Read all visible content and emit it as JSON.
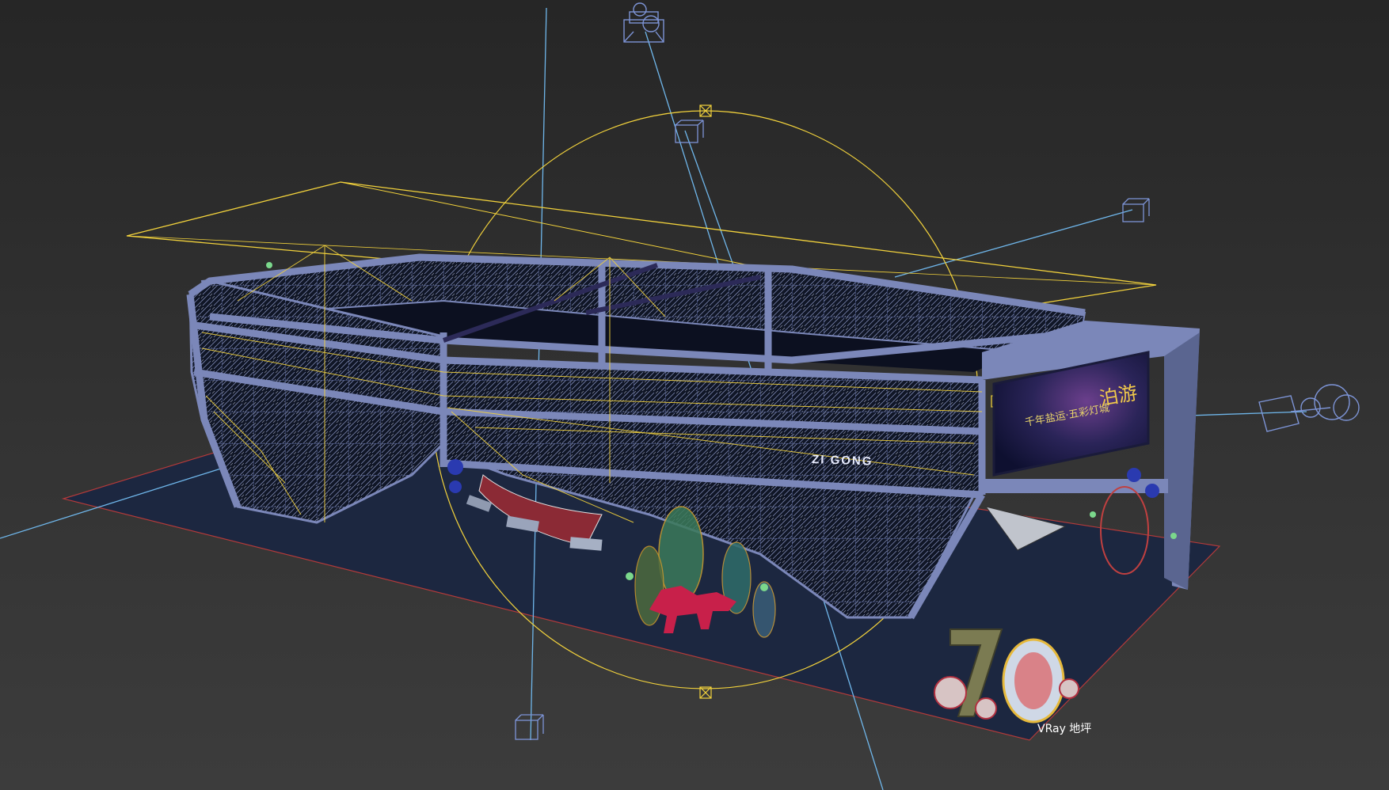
{
  "viewport": {
    "background_top": "#262626",
    "background_bottom": "#3c3c3c"
  },
  "colors": {
    "structure": "#7b87b9",
    "structure_dark": "#5a6590",
    "wireframe_yellow": "#f2d23c",
    "light_blue": "#6fb6ea",
    "gizmo_blue": "#7d94d6",
    "floor": "#1c2740",
    "floor_edge": "#b33a3a",
    "screen_bg": "#1a1b3a",
    "dino_red": "#c8204a",
    "number_olive": "#7b7b52"
  },
  "scene": {
    "front_banner_text": "ZI GONG",
    "screen_caption": "千年盐运·五彩灯城",
    "screen_accent": "泊游",
    "number_object": "70",
    "ground_label": "VRay 地坪"
  },
  "icons": {
    "top_light": "camera-icon",
    "right_light": "spotlight-icon",
    "light_target": "light-target-icon"
  }
}
